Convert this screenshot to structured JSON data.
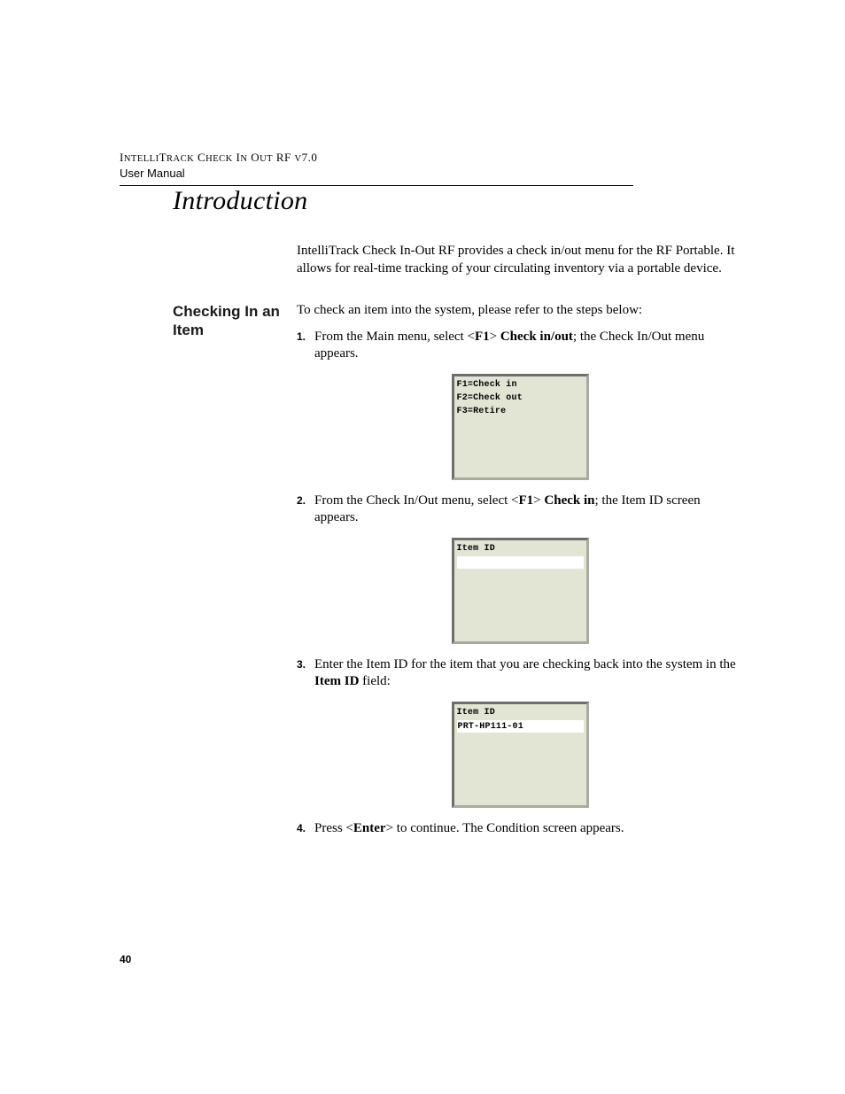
{
  "header": {
    "product_line": "IntelliTrack Check In Out RF v7.0",
    "doc_type": "User Manual"
  },
  "title": "Introduction",
  "intro_paragraph": "IntelliTrack Check In-Out RF provides a check in/out menu for the RF Portable. It allows for real-time tracking of your circulating inventory via a portable device.",
  "section": {
    "heading": "Checking In an Item",
    "lead": "To check an item into the system, please refer to the steps below:",
    "steps": [
      {
        "num": "1.",
        "pre": "From the Main menu, select <",
        "bold1": "F1",
        "mid": "> ",
        "bold2": "Check in/out",
        "post": "; the Check In/Out menu appears."
      },
      {
        "num": "2.",
        "pre": "From the Check In/Out menu, select <",
        "bold1": "F1",
        "mid": "> ",
        "bold2": "Check in",
        "post": "; the Item ID screen appears."
      },
      {
        "num": "3.",
        "pre": "Enter the Item ID for the item that you are checking back into the system in the ",
        "bold1": "Item ID",
        "post": " field:"
      },
      {
        "num": "4.",
        "pre": "Press <",
        "bold1": "Enter",
        "post": "> to continue. The Condition screen appears."
      }
    ]
  },
  "terminals": {
    "menu": {
      "line1": "F1=Check in",
      "line2": "F2=Check out",
      "line3": "F3=Retire"
    },
    "itemid_blank": {
      "label": "Item ID",
      "value": ""
    },
    "itemid_filled": {
      "label": "Item ID",
      "value": "PRT-HP111-01"
    }
  },
  "page_number": "40"
}
